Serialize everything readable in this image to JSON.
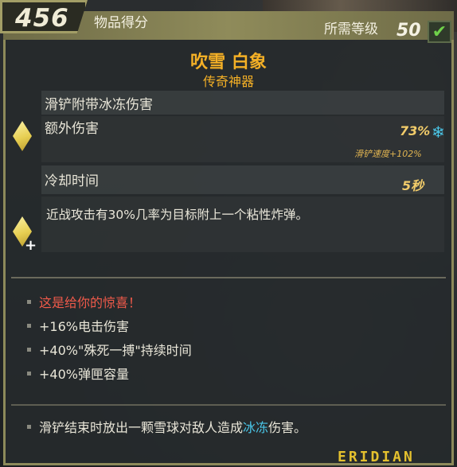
{
  "header": {
    "score": "456",
    "score_label": "物品得分",
    "required_level_label": "所需等级",
    "required_level": "50"
  },
  "item": {
    "name": "吹雪 白象",
    "rarity": "传奇神器"
  },
  "stats": {
    "anointment": "滑铲附带冰冻伤害",
    "bonus_damage_label": "额外伤害",
    "bonus_damage_value": "73%",
    "slide_speed": "滑铲速度+102%",
    "cooldown_label": "冷却时间",
    "cooldown_value": "5秒"
  },
  "effect_text": "近战攻击有30%几率为目标附上一个粘性炸弹。",
  "perks": [
    "这是给你的惊喜！",
    "+16%电击伤害",
    "+40%\"殊死一搏\"持续时间",
    "+40%弹匣容量"
  ],
  "bottom": {
    "part1": "滑铲结束时放出一颗雪球对敌人造成",
    "frost_word": "冰冻",
    "part2": "伤害。"
  },
  "manufacturer": "ERIDIAN",
  "colors": {
    "legendary": "#f4b026",
    "cryo": "#4ac6e8",
    "red_text": "#f05a4a",
    "frame": "#8d8a5a"
  }
}
